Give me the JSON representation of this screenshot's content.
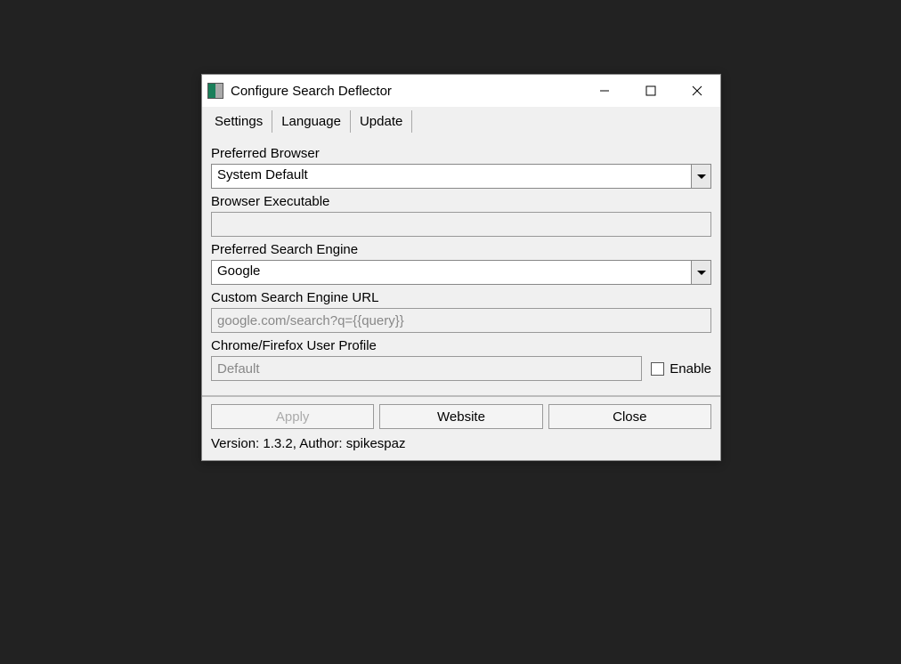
{
  "window": {
    "title": "Configure Search Deflector"
  },
  "tabs": {
    "settings": "Settings",
    "language": "Language",
    "update": "Update"
  },
  "form": {
    "preferred_browser_label": "Preferred Browser",
    "preferred_browser_value": "System Default",
    "browser_executable_label": "Browser Executable",
    "browser_executable_value": "",
    "preferred_search_engine_label": "Preferred Search Engine",
    "preferred_search_engine_value": "Google",
    "custom_search_url_label": "Custom Search Engine URL",
    "custom_search_url_value": "google.com/search?q={{query}}",
    "user_profile_label": "Chrome/Firefox User Profile",
    "user_profile_value": "Default",
    "enable_label": "Enable"
  },
  "buttons": {
    "apply": "Apply",
    "website": "Website",
    "close": "Close"
  },
  "footer": "Version: 1.3.2, Author: spikespaz"
}
